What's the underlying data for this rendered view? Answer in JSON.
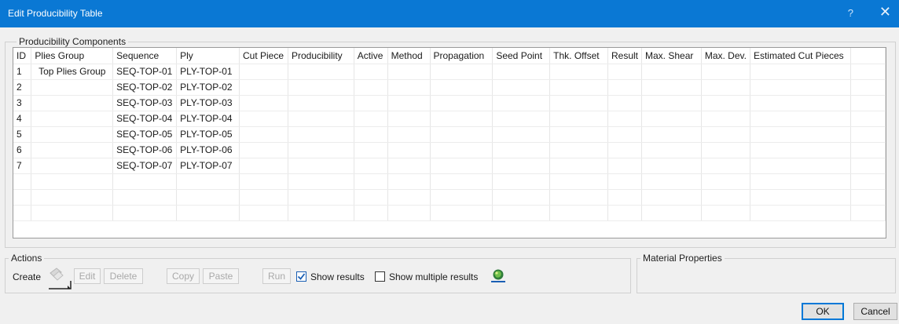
{
  "window": {
    "title": "Edit Producibility Table",
    "help_glyph": "?",
    "close_glyph": "✕"
  },
  "components": {
    "legend": "Producibility Components",
    "columns": [
      "ID",
      "Plies Group",
      "Sequence",
      "Ply",
      "Cut Piece",
      "Producibility",
      "Active",
      "Method",
      "Propagation",
      "Seed Point",
      "Thk. Offset",
      "Result",
      "Max. Shear",
      "Max. Dev.",
      "Estimated Cut Pieces"
    ],
    "rows": [
      {
        "id": "1",
        "group": "Top Plies Group",
        "sequence": "SEQ-TOP-01",
        "ply": "PLY-TOP-01"
      },
      {
        "id": "2",
        "group": "",
        "sequence": "SEQ-TOP-02",
        "ply": "PLY-TOP-02"
      },
      {
        "id": "3",
        "group": "",
        "sequence": "SEQ-TOP-03",
        "ply": "PLY-TOP-03"
      },
      {
        "id": "4",
        "group": "",
        "sequence": "SEQ-TOP-04",
        "ply": "PLY-TOP-04"
      },
      {
        "id": "5",
        "group": "",
        "sequence": "SEQ-TOP-05",
        "ply": "PLY-TOP-05"
      },
      {
        "id": "6",
        "group": "",
        "sequence": "SEQ-TOP-06",
        "ply": "PLY-TOP-06"
      },
      {
        "id": "7",
        "group": "",
        "sequence": "SEQ-TOP-07",
        "ply": "PLY-TOP-07"
      }
    ],
    "empty_rows": 3
  },
  "actions": {
    "legend": "Actions",
    "create_label": "Create",
    "edit_label": "Edit",
    "delete_label": "Delete",
    "copy_label": "Copy",
    "paste_label": "Paste",
    "run_label": "Run",
    "show_results_label": "Show results",
    "show_results_checked": true,
    "show_multiple_label": "Show multiple results",
    "show_multiple_checked": false
  },
  "material": {
    "legend": "Material Properties"
  },
  "footer": {
    "ok_label": "OK",
    "cancel_label": "Cancel"
  },
  "colors": {
    "titlebar": "#0a78d4",
    "check_blue": "#1a5fb4"
  }
}
